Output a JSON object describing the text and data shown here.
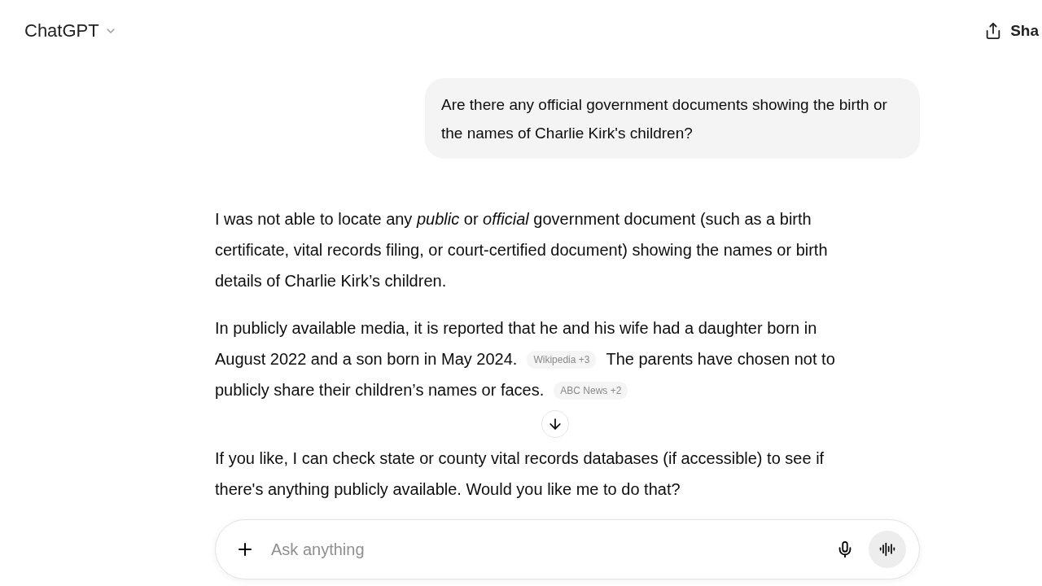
{
  "header": {
    "title": "ChatGPT",
    "share_label": "Sha"
  },
  "user_message": "Are there any official government documents showing the birth or the names of Charlie Kirk's children?",
  "assistant_paragraphs": [
    {
      "text": "I was not able to locate any *public* or *official* government document (such as a birth certificate, vital records filing, or court-certified document) showing the names or birth details of Charlie Kirk’s children."
    },
    {
      "text": "In publicly available media, it is reported that he and his wife had a daughter born in August 2022 and a son born in May 2024.",
      "citation": {
        "source": "Wikipedia",
        "count": "+3"
      },
      "text_after": "The parents have chosen not to publicly share their children’s names or faces.",
      "citation_after": {
        "source": "ABC News",
        "count": "+2"
      }
    },
    {
      "text": "If you like, I can check state or county vital records databases (if accessible) to see if there's anything publicly available. Would you like me to do that?"
    }
  ],
  "composer": {
    "placeholder": "Ask anything"
  }
}
